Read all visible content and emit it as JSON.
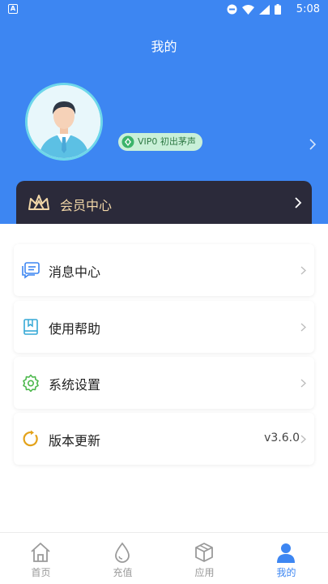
{
  "status_bar": {
    "time": "5:08"
  },
  "page": {
    "title": "我的"
  },
  "profile": {
    "vip_label": "VIP0 初出茅声"
  },
  "member_center": {
    "label": "会员中心"
  },
  "menu": [
    {
      "label": "消息中心",
      "icon": "message-icon",
      "value": ""
    },
    {
      "label": "使用帮助",
      "icon": "book-icon",
      "value": ""
    },
    {
      "label": "系统设置",
      "icon": "gear-icon",
      "value": ""
    },
    {
      "label": "版本更新",
      "icon": "refresh-icon",
      "value": "v3.6.0"
    }
  ],
  "tabs": [
    {
      "label": "首页",
      "icon": "home-icon",
      "active": false
    },
    {
      "label": "充值",
      "icon": "drop-icon",
      "active": false
    },
    {
      "label": "应用",
      "icon": "box-icon",
      "active": false
    },
    {
      "label": "我的",
      "icon": "user-icon",
      "active": true
    }
  ],
  "colors": {
    "brand": "#3d86f2",
    "member_card": "#2b2a3a",
    "gold": "#f2d7a8"
  }
}
